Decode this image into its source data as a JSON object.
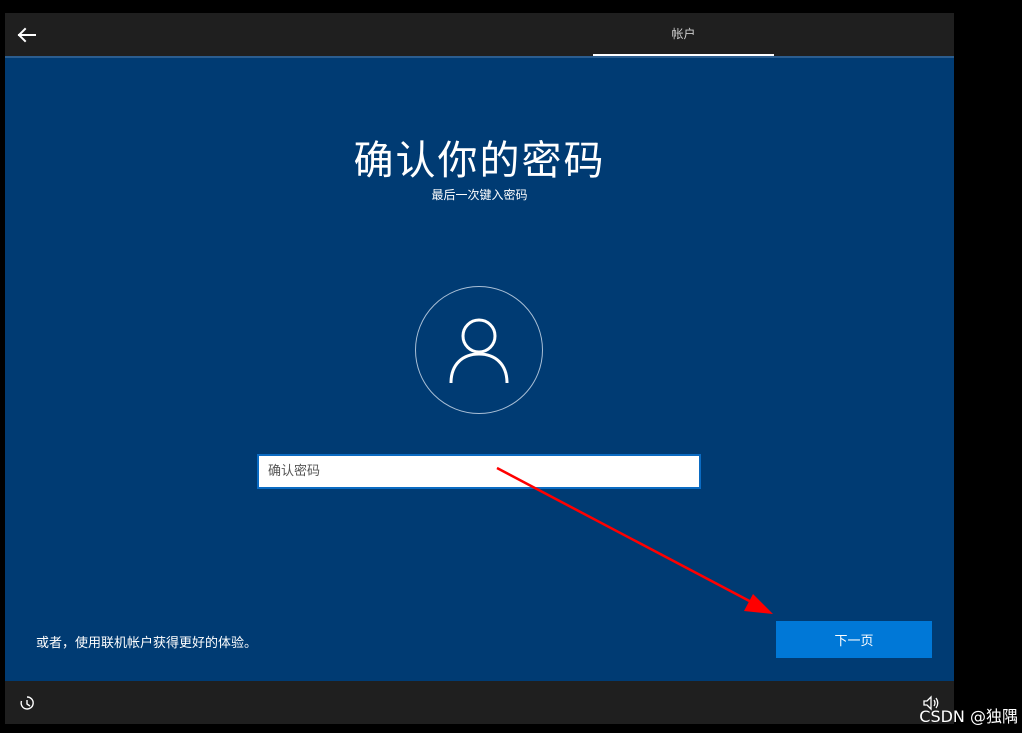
{
  "topbar": {
    "back_icon": "back-arrow-icon",
    "tab_label": "帐户"
  },
  "main": {
    "title": "确认你的密码",
    "subtitle": "最后一次键入密码",
    "avatar_icon": "user-icon",
    "password_placeholder": "确认密码",
    "password_value": ""
  },
  "footer": {
    "online_account_link": "或者，使用联机帐户获得更好的体验。",
    "next_label": "下一页"
  },
  "bottombar": {
    "accessibility_icon": "ease-of-access-icon",
    "volume_icon": "volume-icon"
  },
  "annotation": {
    "arrow_color": "#ff0000"
  },
  "watermark": {
    "text": "CSDN @独隅"
  },
  "colors": {
    "background": "#003b73",
    "accent": "#0078d7",
    "bar": "#1f1f1f"
  }
}
